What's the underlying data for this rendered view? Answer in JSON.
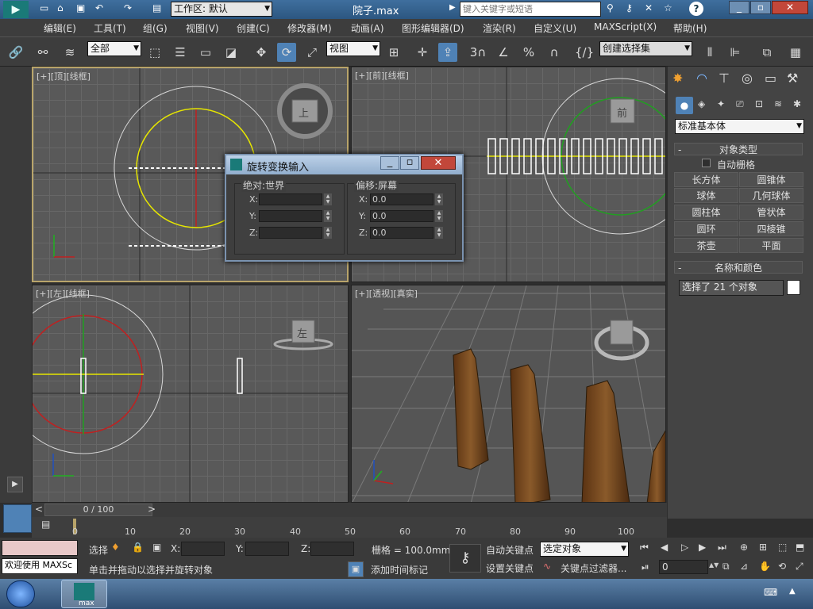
{
  "window": {
    "workspace_label": "工作区: 默认",
    "filename": "院子.max",
    "search_placeholder": "键入关键字或短语"
  },
  "menu": [
    "编辑(E)",
    "工具(T)",
    "组(G)",
    "视图(V)",
    "创建(C)",
    "修改器(M)",
    "动画(A)",
    "图形编辑器(D)",
    "渲染(R)",
    "自定义(U)",
    "MAXScript(X)",
    "帮助(H)"
  ],
  "toolbar": {
    "selection_filter": "全部",
    "ref_coord": "视图",
    "snap_3": "3",
    "snap_percent": "%",
    "named_selection": "创建选择集"
  },
  "viewports": {
    "top": {
      "label": "[+][顶][线框]"
    },
    "front": {
      "label": "[+][前][线框]"
    },
    "left": {
      "label": "[+][左][线框]"
    },
    "persp": {
      "label": "[+][透视][真实]"
    }
  },
  "viewcube": {
    "top": "上",
    "front": "前",
    "left": "左"
  },
  "dialog": {
    "title": "旋转变换输入",
    "absolute_title": "绝对:世界",
    "offset_title": "偏移:屏幕",
    "abs_x_label": "X:",
    "abs_y_label": "Y:",
    "abs_z_label": "Z:",
    "off_x_label": "X:",
    "off_y_label": "Y:",
    "off_z_label": "Z:",
    "off_x": "0.0",
    "off_y": "0.0",
    "off_z": "0.0"
  },
  "command_panel": {
    "category": "标准基本体",
    "object_type_title": "对象类型",
    "autogrid": "自动栅格",
    "buttons": [
      "长方体",
      "圆锥体",
      "球体",
      "几何球体",
      "圆柱体",
      "管状体",
      "圆环",
      "四棱锥",
      "茶壶",
      "平面"
    ],
    "name_color_title": "名称和颜色",
    "name_value": "选择了 21 个对象"
  },
  "timeline": {
    "frame_label": "0 / 100",
    "ticks": [
      "0",
      "10",
      "20",
      "30",
      "40",
      "50",
      "60",
      "70",
      "80",
      "90",
      "100"
    ]
  },
  "status": {
    "listener": "欢迎使用 MAXSc",
    "select_label": "选择",
    "prompt": "单击并拖动以选择并旋转对象",
    "x_label": "X:",
    "y_label": "Y:",
    "z_label": "Z:",
    "grid": "栅格 = 100.0mm",
    "add_time_tag": "添加时间标记",
    "auto_key": "自动关键点",
    "set_key": "设置关键点",
    "key_mode": "选定对象",
    "key_filters": "关键点过滤器...",
    "frame_value": "0"
  },
  "taskbar": {
    "app_label": "max"
  },
  "colors": {
    "accent_blue": "#2c5680",
    "viewport_bg": "#595959",
    "active_border": "#b8a46a",
    "circle_yellow": "#e6e600",
    "circle_red": "#c02020",
    "circle_green": "#20a020"
  }
}
